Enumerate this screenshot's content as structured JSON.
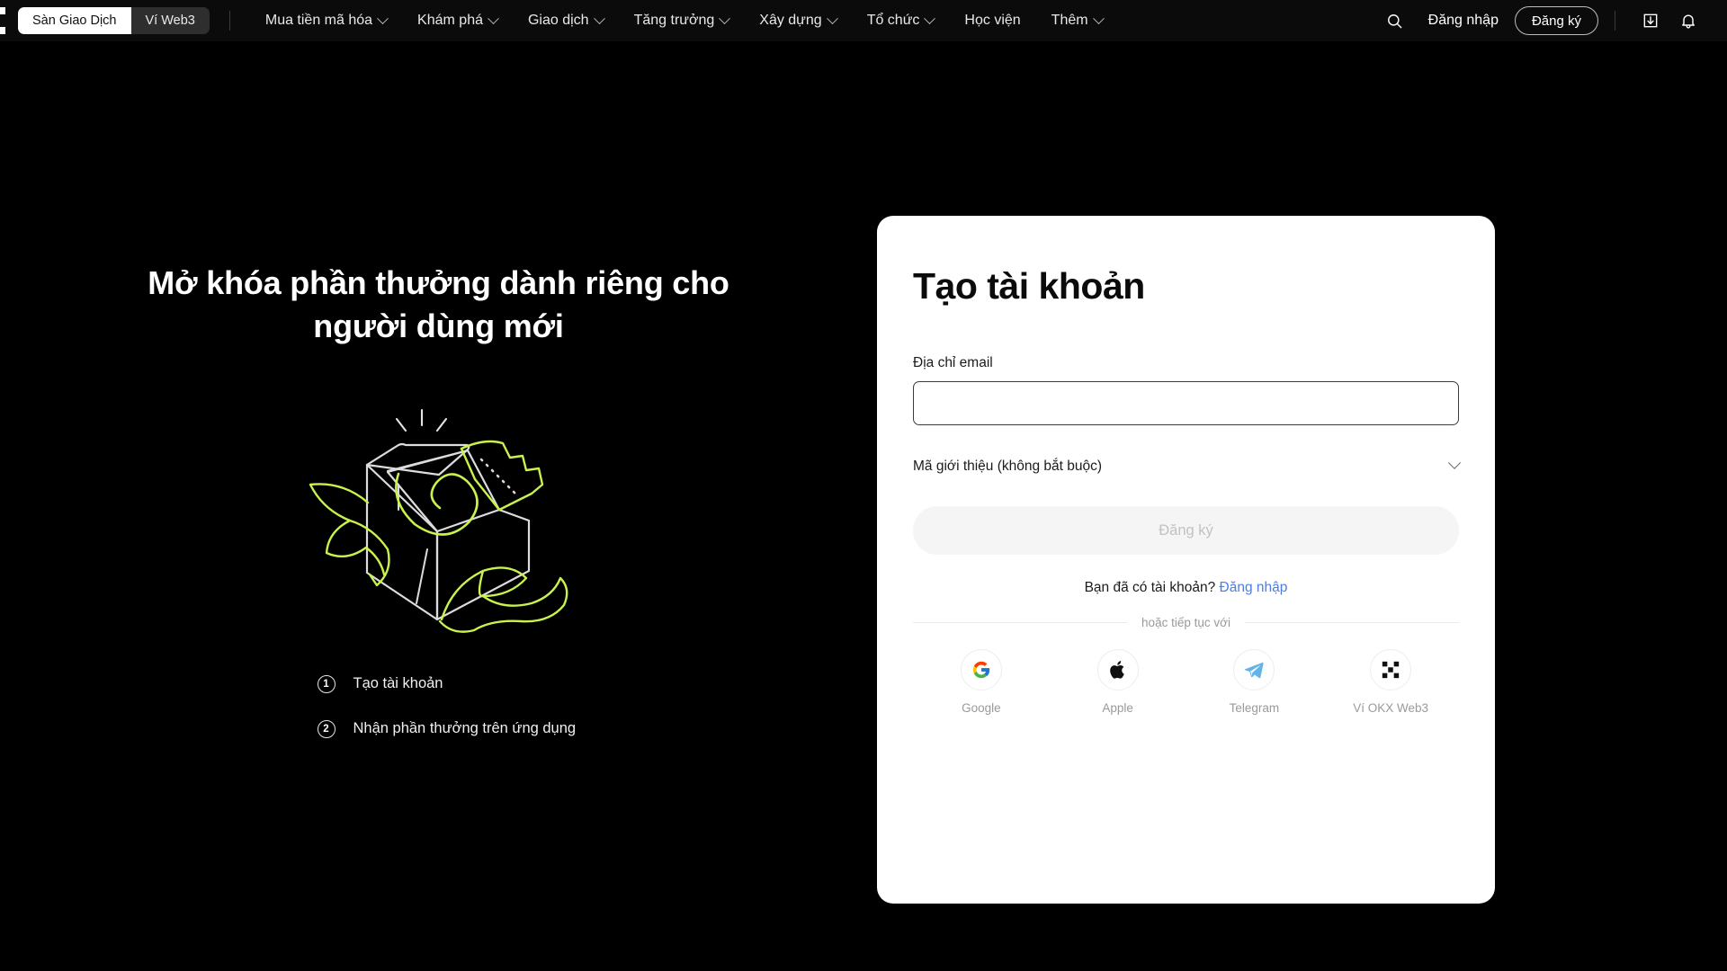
{
  "nav": {
    "logo_icon": "okx-logo-icon",
    "tabs": [
      {
        "label": "Sàn Giao Dịch",
        "active": true
      },
      {
        "label": "Ví Web3",
        "active": false
      }
    ],
    "links": [
      {
        "label": "Mua tiền mã hóa",
        "has_chevron": true
      },
      {
        "label": "Khám phá",
        "has_chevron": true
      },
      {
        "label": "Giao dịch",
        "has_chevron": true
      },
      {
        "label": "Tăng trưởng",
        "has_chevron": true
      },
      {
        "label": "Xây dựng",
        "has_chevron": true
      },
      {
        "label": "Tổ chức",
        "has_chevron": true
      },
      {
        "label": "Học viện",
        "has_chevron": false
      },
      {
        "label": "Thêm",
        "has_chevron": true
      }
    ],
    "search_icon": "search-icon",
    "login_label": "Đăng nhập",
    "register_label": "Đăng ký",
    "download_icon": "download-icon",
    "notification_icon": "bell-icon"
  },
  "hero": {
    "title": "Mở khóa phần thưởng dành riêng cho người dùng mới",
    "illustration": "gift-box-illustration",
    "steps": [
      {
        "number": "1",
        "label": "Tạo tài khoản"
      },
      {
        "number": "2",
        "label": "Nhận phần thưởng trên ứng dụng"
      }
    ]
  },
  "card": {
    "title": "Tạo tài khoản",
    "email_label": "Địa chỉ email",
    "email_value": "",
    "email_placeholder": "",
    "referral_label": "Mã giới thiệu (không bắt buộc)",
    "submit_label": "Đăng ký",
    "have_account_text": "Bạn đã có tài khoản?",
    "login_link_label": "Đăng nhập",
    "or_text": "hoặc tiếp tục với",
    "socials": [
      {
        "label": "Google",
        "icon": "google-icon"
      },
      {
        "label": "Apple",
        "icon": "apple-icon"
      },
      {
        "label": "Telegram",
        "icon": "telegram-icon"
      },
      {
        "label": "Ví OKX Web3",
        "icon": "okx-wallet-icon"
      }
    ]
  },
  "colors": {
    "page_background": "#000000",
    "nav_background": "#0b0b0b",
    "card_background": "#ffffff",
    "accent_link": "#4a7fe0",
    "illustration_green": "#c9f24d",
    "illustration_white": "#e8e8e8",
    "submit_disabled_bg": "#f5f5f5"
  }
}
